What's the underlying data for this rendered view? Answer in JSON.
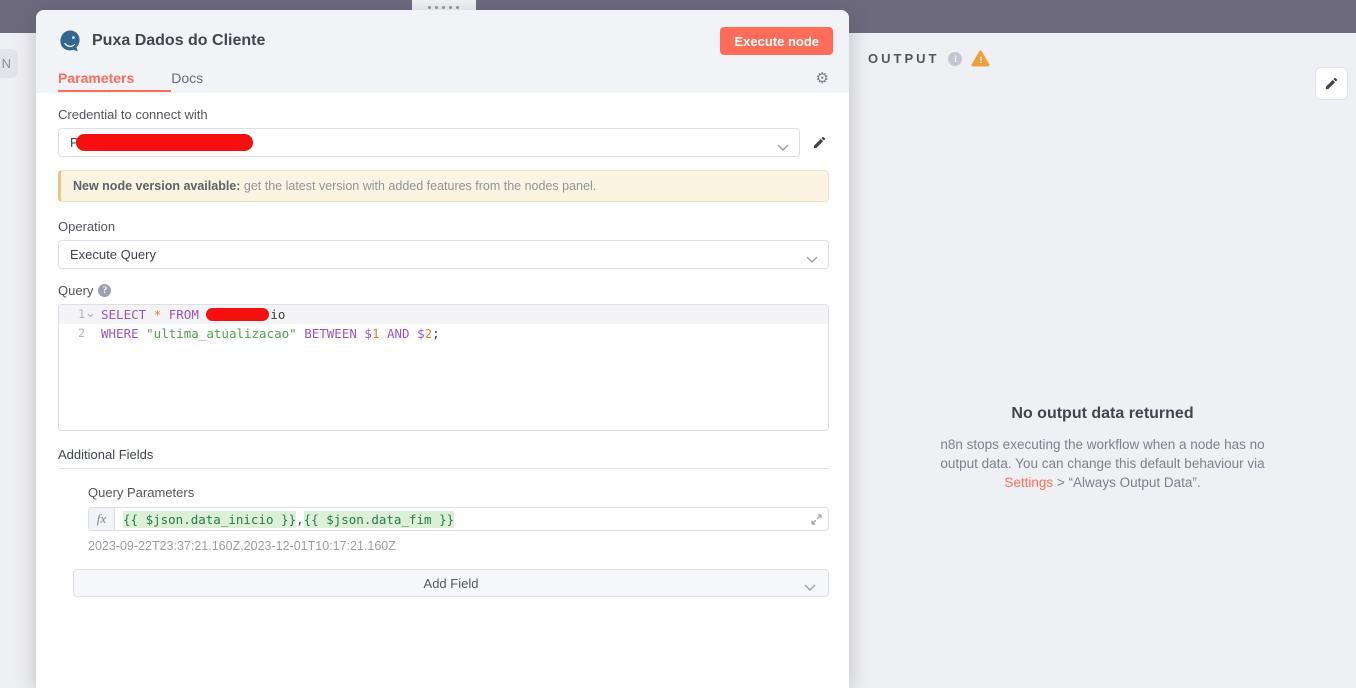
{
  "canvas": {
    "edge_node_label": "N"
  },
  "icons": {
    "gear": "⚙",
    "help": "?",
    "info": "i",
    "warning": "!"
  },
  "colors": {
    "accent": "#ff6d5a",
    "warning": "#eda13c",
    "postgres_blue": "#336791",
    "top_band": "#6e6a7d",
    "redaction": "#f50f0f"
  },
  "modal": {
    "title": "Puxa Dados do Cliente",
    "execute_button": "Execute node",
    "tabs": [
      {
        "label": "Parameters"
      },
      {
        "label": "Docs"
      }
    ],
    "credential": {
      "label": "Credential to connect with",
      "value": "P"
    },
    "notice": {
      "bold": "New node version available:",
      "text": " get the latest version with added features from the nodes panel."
    },
    "operation": {
      "label": "Operation",
      "value": "Execute Query"
    },
    "query": {
      "label": "Query",
      "lines": [
        {
          "num": "1",
          "tokens": [
            {
              "text": "SELECT "
            },
            {
              "text": "* "
            },
            {
              "text": "FROM "
            },
            {
              "text": "io"
            }
          ]
        },
        {
          "num": "2",
          "tokens": [
            {
              "text": "WHERE "
            },
            {
              "text": "\"ultima_atualizacao\""
            },
            {
              "text": " BETWEEN "
            },
            {
              "text": "$"
            },
            {
              "text": "1"
            },
            {
              "text": " AND "
            },
            {
              "text": "$"
            },
            {
              "text": "2"
            },
            {
              "text": ";"
            }
          ]
        }
      ]
    },
    "additional_fields": {
      "heading": "Additional Fields",
      "param_label": "Query Parameters",
      "expression": {
        "prefix": "fx",
        "chunks": [
          {
            "text": "{{ $json.data_inicio }}"
          },
          {
            "text": ","
          },
          {
            "text": "{{ $json.data_fim }}"
          }
        ]
      },
      "preview": "2023-09-22T23:37:21.160Z,2023-12-01T10:17:21.160Z",
      "add_field_label": "Add Field"
    }
  },
  "output_panel": {
    "header": "OUTPUT",
    "empty_title": "No output data returned",
    "body_before": "n8n stops executing the workflow when a node has no output data. You can change this default behaviour via ",
    "settings_link": "Settings",
    "body_after": " > “Always Output Data”."
  }
}
